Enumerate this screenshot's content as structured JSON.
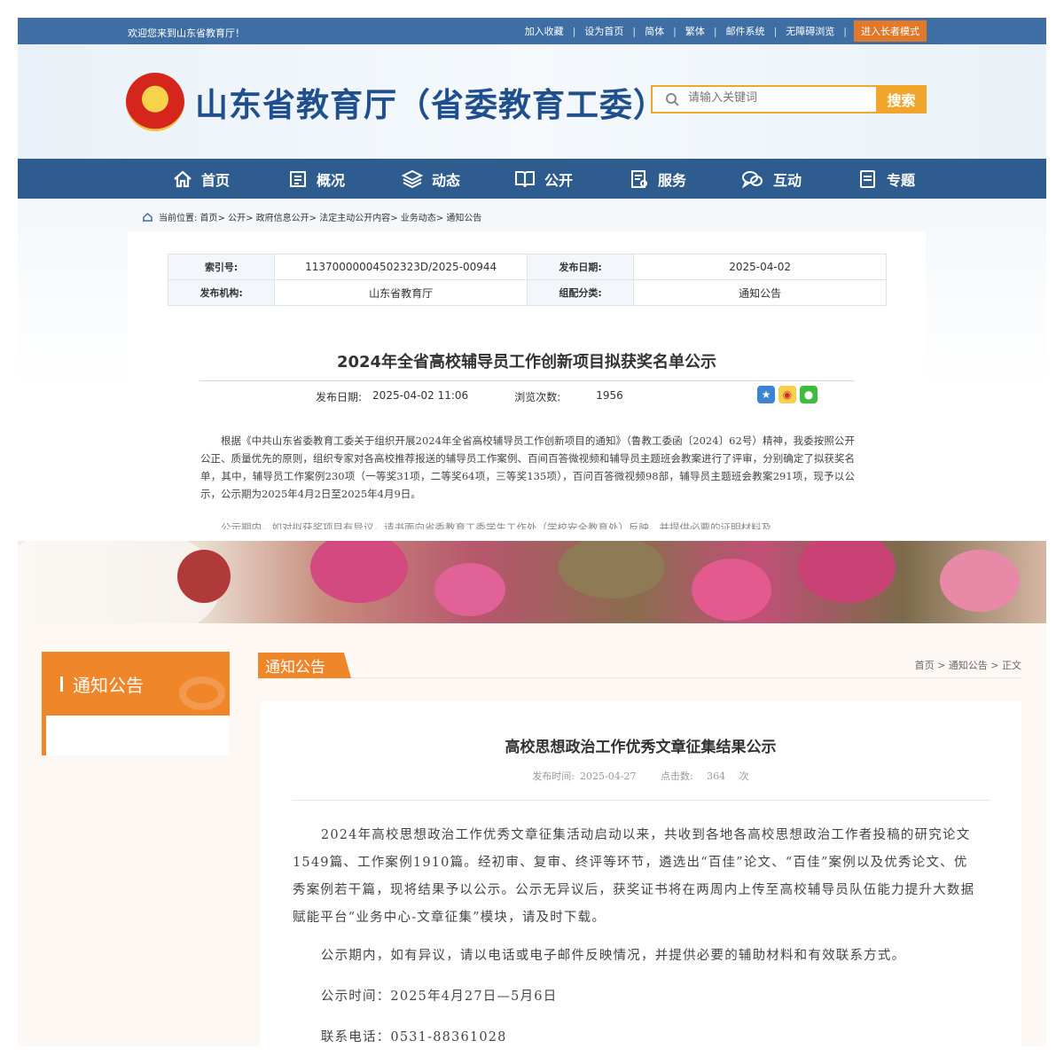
{
  "top": {
    "topbar": {
      "welcome": "欢迎您来到山东省教育厅！",
      "links": [
        "加入收藏",
        "设为首页",
        "简体",
        "繁体",
        "邮件系统",
        "无障碍浏览"
      ],
      "separator": "|",
      "elder_mode": "进入长者模式"
    },
    "site_title": "山东省教育厅（省委教育工委）",
    "search": {
      "placeholder": "请输入关键词",
      "button": "搜索"
    },
    "nav": [
      "首页",
      "概况",
      "动态",
      "公开",
      "服务",
      "互动",
      "专题"
    ],
    "breadcrumb": "当前位置: 首页> 公开> 政府信息公开> 法定主动公开内容> 业务动态> 通知公告",
    "meta_table": [
      [
        "索引号:",
        "11370000004502323D/2025-00944",
        "发布日期:",
        "2025-04-02"
      ],
      [
        "发布机构:",
        "山东省教育厅",
        "组配分类:",
        "通知公告"
      ]
    ],
    "article": {
      "title": "2024年全省高校辅导员工作创新项目拟获奖名单公示",
      "date_label": "发布日期:",
      "date": "2025-04-02 11:06",
      "views_label": "浏览次数:",
      "views": "1956",
      "body": "根据《中共山东省委教育工委关于组织开展2024年全省高校辅导员工作创新项目的通知》（鲁教工委函〔2024〕62号）精神，我委按照公开公正、质量优先的原则，组织专家对各高校推荐报送的辅导员工作案例、百间百答微视频和辅导员主题班会教案进行了评审，分别确定了拟获奖名单，其中，辅导员工作案例230项（一等奖31项，二等奖64项，三等奖135项），百问百答微视频98部，辅导员主题班会教案291项，现予以公示，公示期为2025年4月2日至2025年4月9日。",
      "body_cut": "公示期内，如对拟获奖项目有异议，请书面向省委教育工委学生工作处（学校安全教育处）反映，并提供必要的证明材料及"
    },
    "colors": {
      "topbar": "#3f6ea4",
      "nav": "#2e5c8f",
      "title": "#1f4f8c",
      "search_accent": "#f0a62a",
      "elder": "#e07a2a"
    }
  },
  "bottom": {
    "sidebar_title": "通知公告",
    "section_tab": "通知公告",
    "section_crumb": "首页 > 通知公告 > 正文",
    "article": {
      "title": "高校思想政治工作优秀文章征集结果公示",
      "time_label": "发布时间:",
      "time": "2025-04-27",
      "clicks_label": "点击数:",
      "clicks": "364",
      "clicks_unit": "次",
      "p1": "2024年高校思想政治工作优秀文章征集活动启动以来，共收到各地各高校思想政治工作者投稿的研究论文1549篇、工作案例1910篇。经初审、复审、终评等环节，遴选出“百佳”论文、“百佳”案例以及优秀论文、优秀案例若干篇，现将结果予以公示。公示无异议后，获奖证书将在两周内上传至高校辅导员队伍能力提升大数据赋能平台“业务中心-文章征集”模块，请及时下载。",
      "p2": "公示期内，如有异议，请以电话或电子邮件反映情况，并提供必要的辅助材料和有效联系方式。",
      "p3": "公示时间：2025年4月27日—5月6日",
      "p4": "联系电话：0531-88361028"
    },
    "colors": {
      "accent": "#f0862a",
      "background": "#fdf8f3"
    }
  }
}
